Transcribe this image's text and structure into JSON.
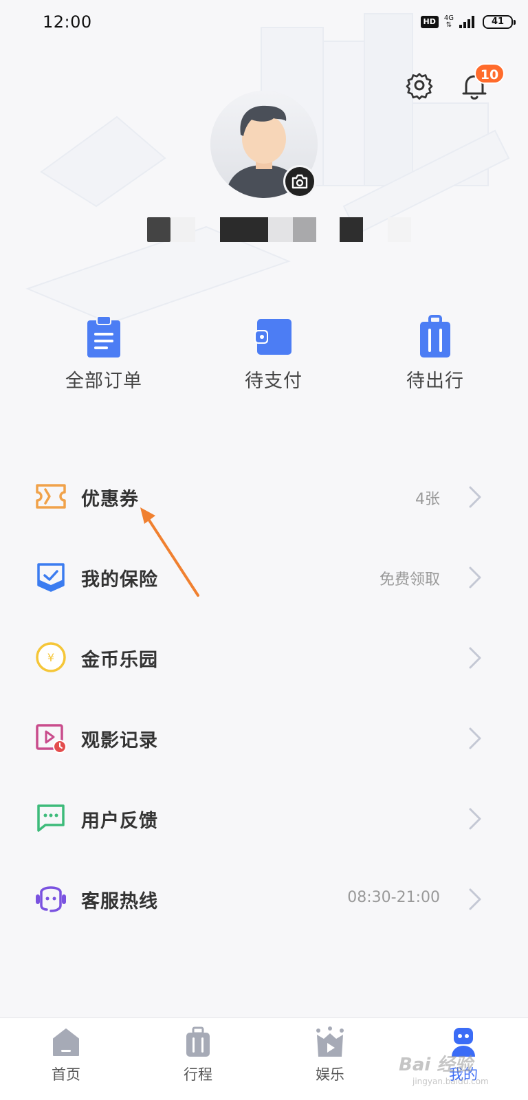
{
  "status_bar": {
    "time": "12:00",
    "hd": "HD",
    "network": "4G",
    "battery": "41"
  },
  "header": {
    "notification_count": "10"
  },
  "quick_actions": [
    {
      "label": "全部订单",
      "icon": "clipboard-icon"
    },
    {
      "label": "待支付",
      "icon": "wallet-icon"
    },
    {
      "label": "待出行",
      "icon": "luggage-icon"
    }
  ],
  "menu": [
    {
      "label": "优惠券",
      "detail": "4张",
      "icon": "coupon-icon",
      "color": "#f0a24a"
    },
    {
      "label": "我的保险",
      "detail": "免费领取",
      "icon": "shield-check-icon",
      "color": "#3b7cf0"
    },
    {
      "label": "金币乐园",
      "detail": "",
      "icon": "gold-coin-icon",
      "color": "#f5c638"
    },
    {
      "label": "观影记录",
      "detail": "",
      "icon": "video-history-icon",
      "color": "#c94c8c"
    },
    {
      "label": "用户反馈",
      "detail": "",
      "icon": "chat-feedback-icon",
      "color": "#3dbb7a"
    },
    {
      "label": "客服热线",
      "detail": "08:30-21:00",
      "icon": "headset-icon",
      "color": "#7a52e0"
    }
  ],
  "tab_bar": [
    {
      "label": "首页",
      "icon": "home-icon",
      "active": false
    },
    {
      "label": "行程",
      "icon": "suitcase-icon",
      "active": false
    },
    {
      "label": "娱乐",
      "icon": "play-crown-icon",
      "active": false
    },
    {
      "label": "我的",
      "icon": "profile-robot-icon",
      "active": true
    }
  ],
  "colors": {
    "accent": "#3b6cf6",
    "badge": "#ff6b2c",
    "annotation_arrow": "#f08030"
  },
  "watermark": {
    "text": "Bai 经验",
    "sub": "jingyan.baidu.com"
  }
}
